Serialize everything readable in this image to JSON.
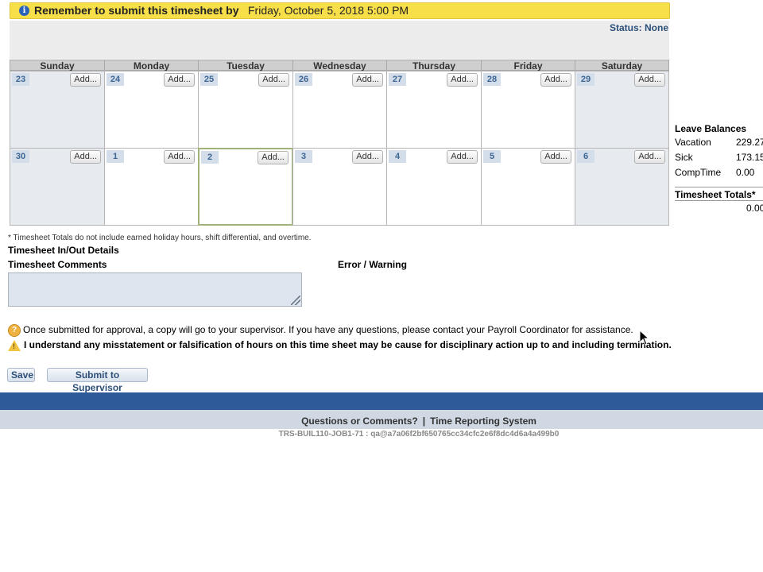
{
  "banner": {
    "bold_text": "Remember to submit this timesheet by",
    "date_text": "Friday, October 5, 2018 5:00 PM"
  },
  "status": "Status: None",
  "calendar": {
    "days": [
      "Sunday",
      "Monday",
      "Tuesday",
      "Wednesday",
      "Thursday",
      "Friday",
      "Saturday"
    ],
    "add_label": "Add...",
    "weeks": [
      [
        "23",
        "24",
        "25",
        "26",
        "27",
        "28",
        "29"
      ],
      [
        "30",
        "1",
        "2",
        "3",
        "4",
        "5",
        "6"
      ]
    ],
    "today": "2"
  },
  "leave_balances": {
    "title": "Leave Balances",
    "rows": [
      {
        "label": "Vacation",
        "value": "229.27"
      },
      {
        "label": "Sick",
        "value": "173.15"
      },
      {
        "label": "CompTime",
        "value": "0.00"
      }
    ],
    "totals_title": "Timesheet Totals*",
    "totals_value": "0.00"
  },
  "footnote": "* Timesheet Totals do not include earned holiday hours, shift differential, and overtime.",
  "inout_title": "Timesheet In/Out Details",
  "comments_title": "Timesheet Comments",
  "comments_value": "",
  "errors_title": "Error / Warning",
  "notices": {
    "info": "Once submitted for approval, a copy will go to your supervisor. If you have any questions, please contact your Payroll Coordinator for assistance.",
    "warning": "I understand any misstatement or falsification of hours on this time sheet may be cause for disciplinary action up to and including termination."
  },
  "buttons": {
    "save": "Save",
    "submit": "Submit to Supervisor"
  },
  "footer": {
    "questions": "Questions or Comments?",
    "separator": "|",
    "system": "Time Reporting System",
    "build": "TRS-BUIL110-JOB1-71 : qa@a7a06f2bf650765cc34cfc2e6f8dc4d6a4a499b0"
  },
  "colors": {
    "banner": "#f7df4a",
    "accent": "#2e5a9a",
    "weekend": "#e7ebf0"
  }
}
